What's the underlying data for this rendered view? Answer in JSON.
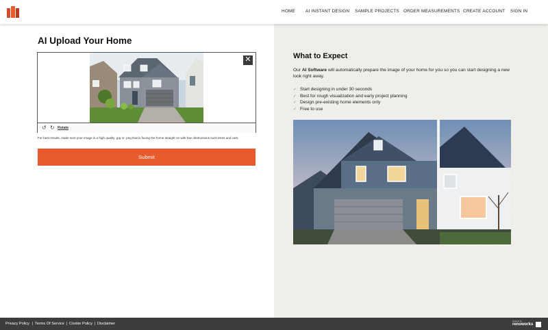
{
  "nav": {
    "items": [
      "HOME",
      "AI INSTANT DESIGN",
      "SAMPLE PROJECTS",
      "ORDER MEASUREMENTS",
      "CREATE ACCOUNT",
      "SIGN IN"
    ]
  },
  "upload": {
    "title": "AI Upload Your Home",
    "close_symbol": "✕",
    "rotate_label": "Rotate",
    "hint": "For best results, make sure your image is a high quality .jpg or .png that is facing the home straight on with few obstructions such trees and cars.",
    "submit_label": "Submit"
  },
  "expect": {
    "title": "What to Expect",
    "desc_prefix": "Our ",
    "desc_bold": "AI Software",
    "desc_suffix": " will automatically prepare the image of your home for you so you can start designing a new look right away.",
    "items": [
      "Start designing in under 30 seconds",
      "Best for rough visualization and early project planning",
      "Design pre-existing home elements only",
      "Free to use"
    ]
  },
  "footer": {
    "links": [
      "Privacy Policy",
      "Terms Of Service",
      "Cookie Policy",
      "Disclaimer"
    ],
    "separator": "|",
    "powered_by": "Powered by",
    "brand": "renoworks"
  },
  "icons": {
    "logo": "renoworks-logo",
    "close": "close-icon",
    "rotate_left": "rotate-left-icon",
    "rotate_right": "rotate-right-icon",
    "check": "check-icon"
  },
  "colors": {
    "accent": "#e95a2d",
    "footer_bg": "#3d3d3d",
    "right_bg": "#f1f0ed"
  }
}
